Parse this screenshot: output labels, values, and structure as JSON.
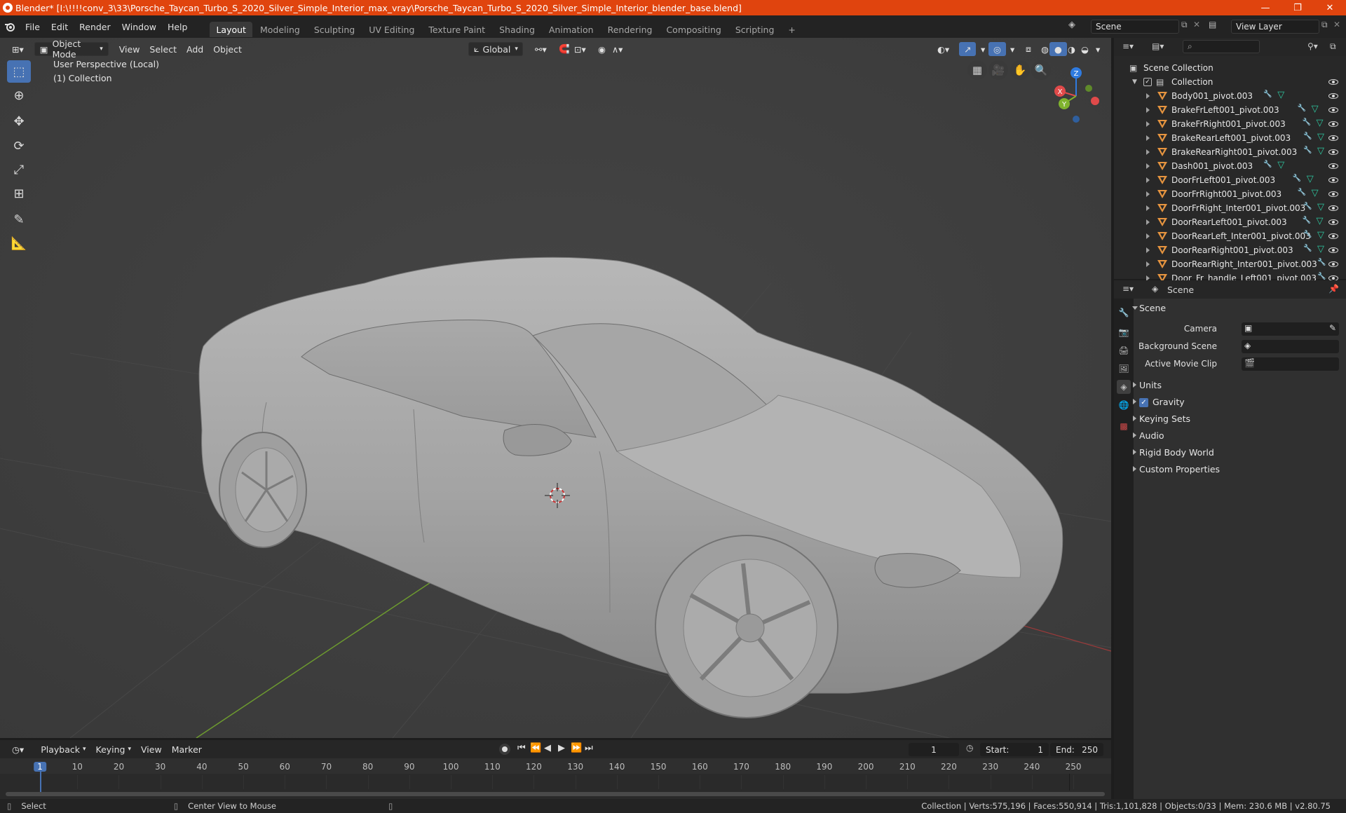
{
  "window": {
    "title": "Blender* [I:\\!!!!conv_3\\33\\Porsche_Taycan_Turbo_S_2020_Silver_Simple_Interior_max_vray\\Porsche_Taycan_Turbo_S_2020_Silver_Simple_Interior_blender_base.blend]",
    "minimize": "—",
    "maximize": "❐",
    "close": "✕"
  },
  "menubar": {
    "menus": [
      "File",
      "Edit",
      "Render",
      "Window",
      "Help"
    ],
    "workspaces": [
      "Layout",
      "Modeling",
      "Sculpting",
      "UV Editing",
      "Texture Paint",
      "Shading",
      "Animation",
      "Rendering",
      "Compositing",
      "Scripting"
    ],
    "active_workspace": "Layout",
    "add_workspace": "+",
    "scene_label": "Scene",
    "view_layer_label": "View Layer"
  },
  "viewport": {
    "mode": "Object Mode",
    "menus": [
      "View",
      "Select",
      "Add",
      "Object"
    ],
    "transform_orientation": "Global",
    "perspective_label": "User Perspective (Local)",
    "collection_label": "(1) Collection",
    "gizmo": {
      "x": "X",
      "y": "Y",
      "z": "Z"
    }
  },
  "outliner": {
    "search_placeholder": "",
    "scene_collection": "Scene Collection",
    "collection": "Collection",
    "objects": [
      {
        "name": "Body001_pivot.003",
        "mods": 2
      },
      {
        "name": "BrakeFrLeft001_pivot.003",
        "mods": 2
      },
      {
        "name": "BrakeFrRight001_pivot.003",
        "mods": 2
      },
      {
        "name": "BrakeRearLeft001_pivot.003",
        "mods": 2
      },
      {
        "name": "BrakeRearRight001_pivot.003",
        "mods": 2
      },
      {
        "name": "Dash001_pivot.003",
        "mods": 2
      },
      {
        "name": "DoorFrLeft001_pivot.003",
        "mods": 2
      },
      {
        "name": "DoorFrRight001_pivot.003",
        "mods": 2
      },
      {
        "name": "DoorFrRight_Inter001_pivot.003",
        "mods": 2
      },
      {
        "name": "DoorRearLeft001_pivot.003",
        "mods": 2
      },
      {
        "name": "DoorRearLeft_Inter001_pivot.003",
        "mods": 2
      },
      {
        "name": "DoorRearRight001_pivot.003",
        "mods": 2
      },
      {
        "name": "DoorRearRight_Inter001_pivot.003",
        "mods": 1
      },
      {
        "name": "Door_Fr_handle_Left001_pivot.003",
        "mods": 1
      }
    ]
  },
  "properties": {
    "context": "Scene",
    "section_scene": "Scene",
    "camera_label": "Camera",
    "background_scene_label": "Background Scene",
    "active_movie_clip_label": "Active Movie Clip",
    "sections": [
      "Units",
      "Gravity",
      "Keying Sets",
      "Audio",
      "Rigid Body World",
      "Custom Properties"
    ],
    "gravity_checked": true
  },
  "timeline": {
    "menus": [
      "Playback",
      "Keying",
      "View",
      "Marker"
    ],
    "current_frame": "1",
    "start_label": "Start:",
    "start_value": "1",
    "end_label": "End:",
    "end_value": "250",
    "ruler": [
      "1",
      "10",
      "20",
      "30",
      "40",
      "50",
      "60",
      "70",
      "80",
      "90",
      "100",
      "110",
      "120",
      "130",
      "140",
      "150",
      "160",
      "170",
      "180",
      "190",
      "200",
      "210",
      "220",
      "230",
      "240",
      "250"
    ]
  },
  "statusbar": {
    "left": "Select",
    "middle": "Center View to Mouse",
    "right": "Collection | Verts:575,196 | Faces:550,914 | Tris:1,101,828 | Objects:0/33 | Mem: 230.6 MB | v2.80.75"
  }
}
